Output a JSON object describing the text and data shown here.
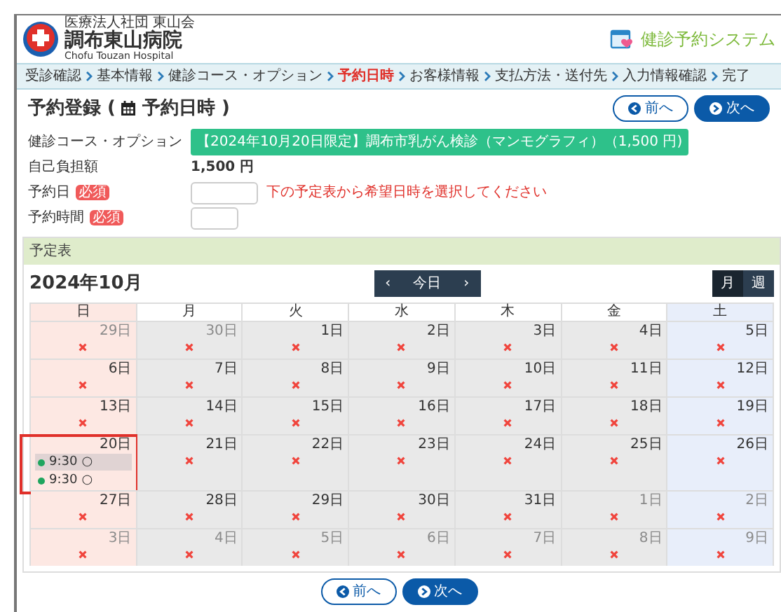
{
  "header": {
    "org": "医療法人社団 東山会",
    "hospital": "調布東山病院",
    "hospital_en": "Chofu Touzan Hospital",
    "system": "健診予約システム"
  },
  "breadcrumb": [
    {
      "label": "受診確認",
      "current": false
    },
    {
      "label": "基本情報",
      "current": false
    },
    {
      "label": "健診コース・オプション",
      "current": false
    },
    {
      "label": "予約日時",
      "current": true
    },
    {
      "label": "お客様情報",
      "current": false
    },
    {
      "label": "支払方法・送付先",
      "current": false
    },
    {
      "label": "入力情報確認",
      "current": false
    },
    {
      "label": "完了",
      "current": false
    }
  ],
  "page_title": {
    "before": "予約登録 (",
    "after": "予約日時 )"
  },
  "nav_buttons": [
    {
      "label": "前へ",
      "kind": "prev"
    },
    {
      "label": "次へ",
      "kind": "next"
    }
  ],
  "form": [
    {
      "label": "健診コース・オプション",
      "kind": "badge",
      "value": "【2024年10月20日限定】調布市乳がん検診（マンモグラフィ）（1,500 円)"
    },
    {
      "label": "自己負担額",
      "kind": "text",
      "value": "1,500 円"
    },
    {
      "label": "予約日",
      "badge": "必須",
      "kind": "date",
      "hint": "下の予定表から希望日時を選択してください"
    },
    {
      "label": "予約時間",
      "badge": "必須",
      "kind": "time"
    }
  ],
  "schedule": {
    "panel_title": "予定表",
    "month": "2024年10月",
    "prev": "‹",
    "today": "今日",
    "next": "›",
    "views": [
      {
        "label": "月",
        "selected": true
      },
      {
        "label": "週",
        "selected": false
      }
    ],
    "weekdays": [
      "日",
      "月",
      "火",
      "水",
      "木",
      "金",
      "土"
    ],
    "days": [
      {
        "label": "29日",
        "muted": true,
        "kind": "closed"
      },
      {
        "label": "30日",
        "muted": true,
        "kind": "closed"
      },
      {
        "label": "1日",
        "muted": false,
        "kind": "closed"
      },
      {
        "label": "2日",
        "muted": false,
        "kind": "closed"
      },
      {
        "label": "3日",
        "muted": false,
        "kind": "closed"
      },
      {
        "label": "4日",
        "muted": false,
        "kind": "closed"
      },
      {
        "label": "5日",
        "muted": false,
        "kind": "closed"
      },
      {
        "label": "6日",
        "muted": false,
        "kind": "closed"
      },
      {
        "label": "7日",
        "muted": false,
        "kind": "closed"
      },
      {
        "label": "8日",
        "muted": false,
        "kind": "closed"
      },
      {
        "label": "9日",
        "muted": false,
        "kind": "closed"
      },
      {
        "label": "10日",
        "muted": false,
        "kind": "closed"
      },
      {
        "label": "11日",
        "muted": false,
        "kind": "closed"
      },
      {
        "label": "12日",
        "muted": false,
        "kind": "closed"
      },
      {
        "label": "13日",
        "muted": false,
        "kind": "closed"
      },
      {
        "label": "14日",
        "muted": false,
        "kind": "closed"
      },
      {
        "label": "15日",
        "muted": false,
        "kind": "closed"
      },
      {
        "label": "16日",
        "muted": false,
        "kind": "closed"
      },
      {
        "label": "17日",
        "muted": false,
        "kind": "closed"
      },
      {
        "label": "18日",
        "muted": false,
        "kind": "closed"
      },
      {
        "label": "19日",
        "muted": false,
        "kind": "closed"
      },
      {
        "label": "20日",
        "muted": false,
        "kind": "open",
        "highlighted": true,
        "slots": [
          {
            "time": "9:30",
            "mark": "○",
            "selected": true
          },
          {
            "time": "9:30",
            "mark": "○",
            "selected": false
          }
        ]
      },
      {
        "label": "21日",
        "muted": false,
        "kind": "closed"
      },
      {
        "label": "22日",
        "muted": false,
        "kind": "closed"
      },
      {
        "label": "23日",
        "muted": false,
        "kind": "closed"
      },
      {
        "label": "24日",
        "muted": false,
        "kind": "closed"
      },
      {
        "label": "25日",
        "muted": false,
        "kind": "closed"
      },
      {
        "label": "26日",
        "muted": false,
        "kind": "closed"
      },
      {
        "label": "27日",
        "muted": false,
        "kind": "closed"
      },
      {
        "label": "28日",
        "muted": false,
        "kind": "closed"
      },
      {
        "label": "29日",
        "muted": false,
        "kind": "closed"
      },
      {
        "label": "30日",
        "muted": false,
        "kind": "closed"
      },
      {
        "label": "31日",
        "muted": false,
        "kind": "closed"
      },
      {
        "label": "1日",
        "muted": true,
        "kind": "closed"
      },
      {
        "label": "2日",
        "muted": true,
        "kind": "closed"
      },
      {
        "label": "3日",
        "muted": true,
        "kind": "closed"
      },
      {
        "label": "4日",
        "muted": true,
        "kind": "closed"
      },
      {
        "label": "5日",
        "muted": true,
        "kind": "closed"
      },
      {
        "label": "6日",
        "muted": true,
        "kind": "closed"
      },
      {
        "label": "7日",
        "muted": true,
        "kind": "closed"
      },
      {
        "label": "8日",
        "muted": true,
        "kind": "closed"
      },
      {
        "label": "9日",
        "muted": true,
        "kind": "closed"
      }
    ]
  },
  "bottom_buttons": [
    {
      "label": "前へ",
      "kind": "prev"
    },
    {
      "label": "次へ",
      "kind": "next"
    }
  ]
}
